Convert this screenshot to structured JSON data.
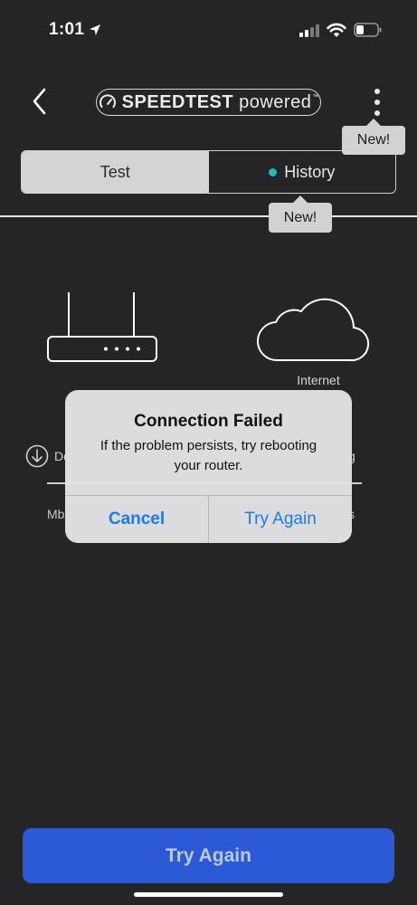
{
  "status_bar": {
    "time": "1:01",
    "icons": [
      "location-arrow-icon",
      "cellular-signal-icon",
      "wifi-icon",
      "battery-icon"
    ]
  },
  "header": {
    "logo_main": "SPEEDTEST",
    "logo_sub": "powered",
    "logo_tm": "™",
    "back_icon": "chevron-left-icon",
    "menu_icon": "more-vertical-icon"
  },
  "tooltips": {
    "menu_new": "New!",
    "history_new": "New!"
  },
  "tabs": [
    {
      "label": "Test",
      "selected": true
    },
    {
      "label": "History",
      "selected": false,
      "indicator_color": "#23b8c0"
    }
  ],
  "diagram": {
    "router_icon": "router-icon",
    "cloud_icon": "cloud-icon",
    "internet_label": "Internet"
  },
  "metrics": {
    "download_label_visible": "Do",
    "upload_label_visible": "g",
    "unit_left_visible": "Mb",
    "unit_right_visible": "s"
  },
  "alert": {
    "title": "Connection Failed",
    "message": "If the problem persists, try rebooting your router.",
    "cancel_label": "Cancel",
    "retry_label": "Try Again"
  },
  "footer": {
    "cta_label": "Try Again"
  },
  "colors": {
    "background": "#252427",
    "accent_blue": "#2c5ad6",
    "ios_blue": "#1a7cf0",
    "teal": "#23b8c0"
  }
}
